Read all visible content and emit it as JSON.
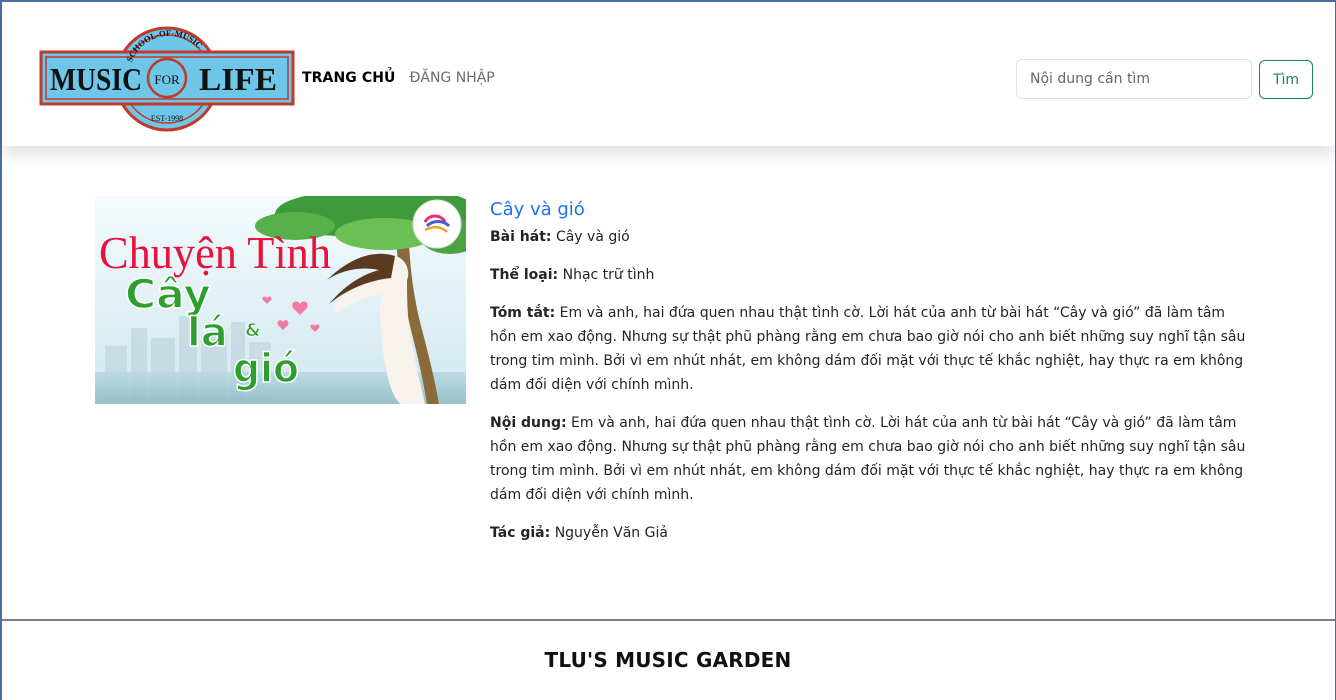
{
  "header": {
    "logo": {
      "top_text": "SCHOOL-OF-MUSIC",
      "left_word": "MUSIC",
      "center_word": "FOR",
      "right_word": "LIFE",
      "bottom_text": "EST-1998"
    },
    "nav": {
      "home_label": "TRANG CHỦ",
      "login_label": "ĐĂNG NHẬP"
    },
    "search": {
      "placeholder": "Nội dung cần tìm",
      "button_label": "Tìm"
    }
  },
  "song": {
    "cover": {
      "title_line1": "Chuyện Tình",
      "title_word1": "Cây",
      "title_word2": "lá",
      "title_amp": "&",
      "title_word3": "gió"
    },
    "title": "Cây và gió",
    "fields": {
      "song_label": "Bài hát:",
      "song_value": "Cây và gió",
      "genre_label": "Thể loại:",
      "genre_value": "Nhạc trữ tình",
      "summary_label": "Tóm tắt:",
      "summary_value": "Em và anh, hai đứa quen nhau thật tình cờ. Lời hát của anh từ bài hát “Cây và gió” đã làm tâm hồn em xao động. Nhưng sự thật phũ phàng rằng em chưa bao giờ nói cho anh biết những suy nghĩ tận sâu trong tim mình. Bởi vì em nhút nhát, em không dám đối mặt với thực tế khắc nghiệt, hay thực ra em không dám đối diện với chính mình.",
      "content_label": "Nội dung:",
      "content_value": "Em và anh, hai đứa quen nhau thật tình cờ. Lời hát của anh từ bài hát “Cây và gió” đã làm tâm hồn em xao động. Nhưng sự thật phũ phàng rằng em chưa bao giờ nói cho anh biết những suy nghĩ tận sâu trong tim mình. Bởi vì em nhút nhát, em không dám đối mặt với thực tế khắc nghiệt, hay thực ra em không dám đối diện với chính mình.",
      "author_label": "Tác giả:",
      "author_value": "Nguyễn Văn Giả"
    }
  },
  "footer": {
    "title": "TLU'S MUSIC GARDEN"
  },
  "colors": {
    "link_blue": "#1a73e8",
    "success_green": "#198754",
    "logo_blue": "#6ec6e8",
    "logo_red": "#c0392b",
    "cover_pink": "#e8123c",
    "cover_green": "#2e9e2e"
  }
}
